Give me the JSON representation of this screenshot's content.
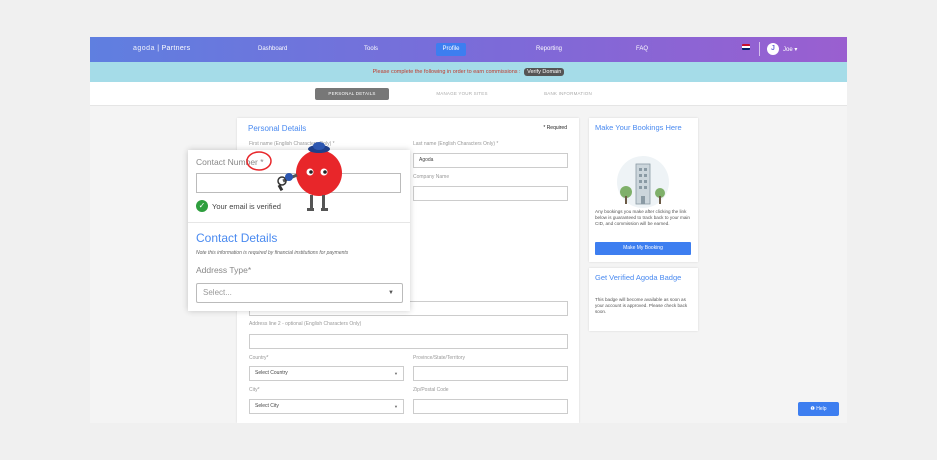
{
  "topnav": {
    "logo_dots": "agoda",
    "logo_text": "| Partners",
    "items": [
      "Dashboard",
      "Tools",
      "Profile",
      "Reporting",
      "FAQ"
    ],
    "user_initial": "J",
    "user_name": "Joe ▾"
  },
  "alert": {
    "message": "Please complete the following in order to earn commissions :",
    "button": "Verify Domain"
  },
  "subtabs": [
    "PERSONAL DETAILS",
    "MANAGE YOUR SITES",
    "BANK INFORMATION"
  ],
  "personal": {
    "title": "Personal Details",
    "required": "* Required",
    "first_name_label": "First name (English Characters Only) *",
    "last_name_label": "Last name (English Characters Only) *",
    "last_name_value": "Agoda",
    "company_label": "Company Name",
    "address2_label": "Address line 2 - optional (English Characters Only)",
    "country_label": "Country*",
    "country_value": "Select Country",
    "province_label": "Province/State/Territory",
    "city_label": "City*",
    "city_value": "Select City",
    "zip_label": "Zip/Postal Code"
  },
  "popup": {
    "contact_number_label": "Contact Number *",
    "email_verified": "Your email is verified",
    "contact_details_title": "Contact Details",
    "note": "Note this information is required by financial institutions for payments",
    "address_type_label": "Address Type*",
    "address_type_value": "Select..."
  },
  "sidebar": {
    "bookings_title": "Make Your Bookings Here",
    "bookings_text": "Any bookings you make after clicking the link below is guaranteed to track back to your main CID, and commission will be earned.",
    "bookings_button": "Make My Booking",
    "badge_title": "Get Verified Agoda Badge",
    "badge_text": "This badge will become available as soon as your account is approved. Please check back soon."
  },
  "help_button": "❶ Help",
  "colors": {
    "accent": "#3d7ef0",
    "heading": "#4a8af0",
    "verified": "#2e9e3e",
    "mascot": "#e8262a"
  }
}
